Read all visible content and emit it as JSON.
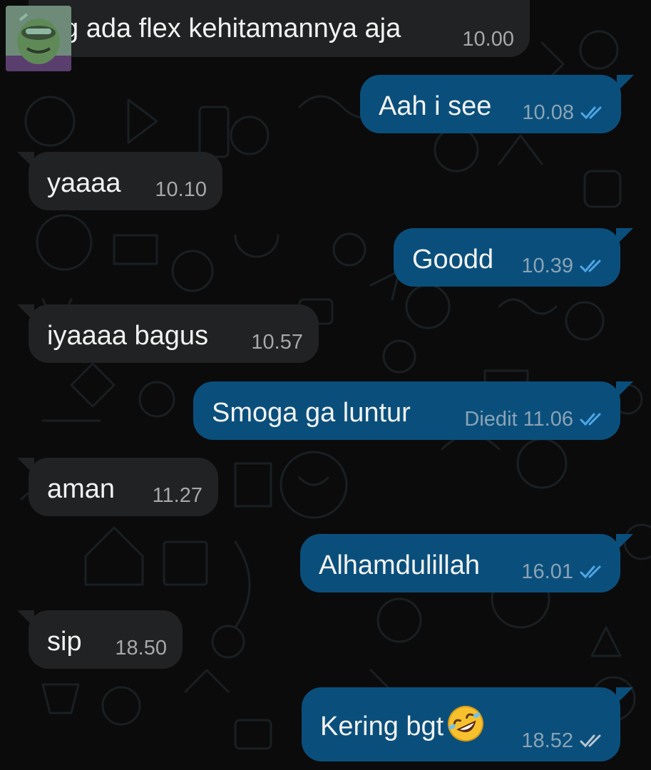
{
  "messages": [
    {
      "id": "m1",
      "direction": "incoming",
      "text": "yg ada flex kehitamannya aja",
      "time": "10.00"
    },
    {
      "id": "m2",
      "direction": "outgoing",
      "text": "Aah i see",
      "time": "10.08",
      "status_icon": "double-check-read-icon"
    },
    {
      "id": "m3",
      "direction": "incoming",
      "text": "yaaaa",
      "time": "10.10"
    },
    {
      "id": "m4",
      "direction": "outgoing",
      "text": "Goodd",
      "time": "10.39",
      "status_icon": "double-check-read-icon"
    },
    {
      "id": "m5",
      "direction": "incoming",
      "text": "iyaaaa bagus",
      "time": "10.57"
    },
    {
      "id": "m6",
      "direction": "outgoing",
      "text": "Smoga ga luntur",
      "edited_label": "Diedit",
      "time": "11.06",
      "status_icon": "double-check-read-icon"
    },
    {
      "id": "m7",
      "direction": "incoming",
      "text": "aman",
      "time": "11.27"
    },
    {
      "id": "m8",
      "direction": "outgoing",
      "text": "Alhamdulillah",
      "time": "16.01",
      "status_icon": "double-check-read-icon"
    },
    {
      "id": "m9",
      "direction": "incoming",
      "text": "sip",
      "time": "18.50"
    },
    {
      "id": "m10",
      "direction": "outgoing",
      "text": "Kering bgt",
      "emoji_icon": "rolling-laughing-emoji-icon",
      "time": "18.52",
      "status_icon": "double-check-delivered-icon"
    }
  ],
  "colors": {
    "background": "#0b0b0c",
    "incoming_bubble": "#202224",
    "outgoing_bubble": "#0a4f7c",
    "read_check": "#4fa6e6",
    "delivered_check": "#b9c6d0"
  }
}
